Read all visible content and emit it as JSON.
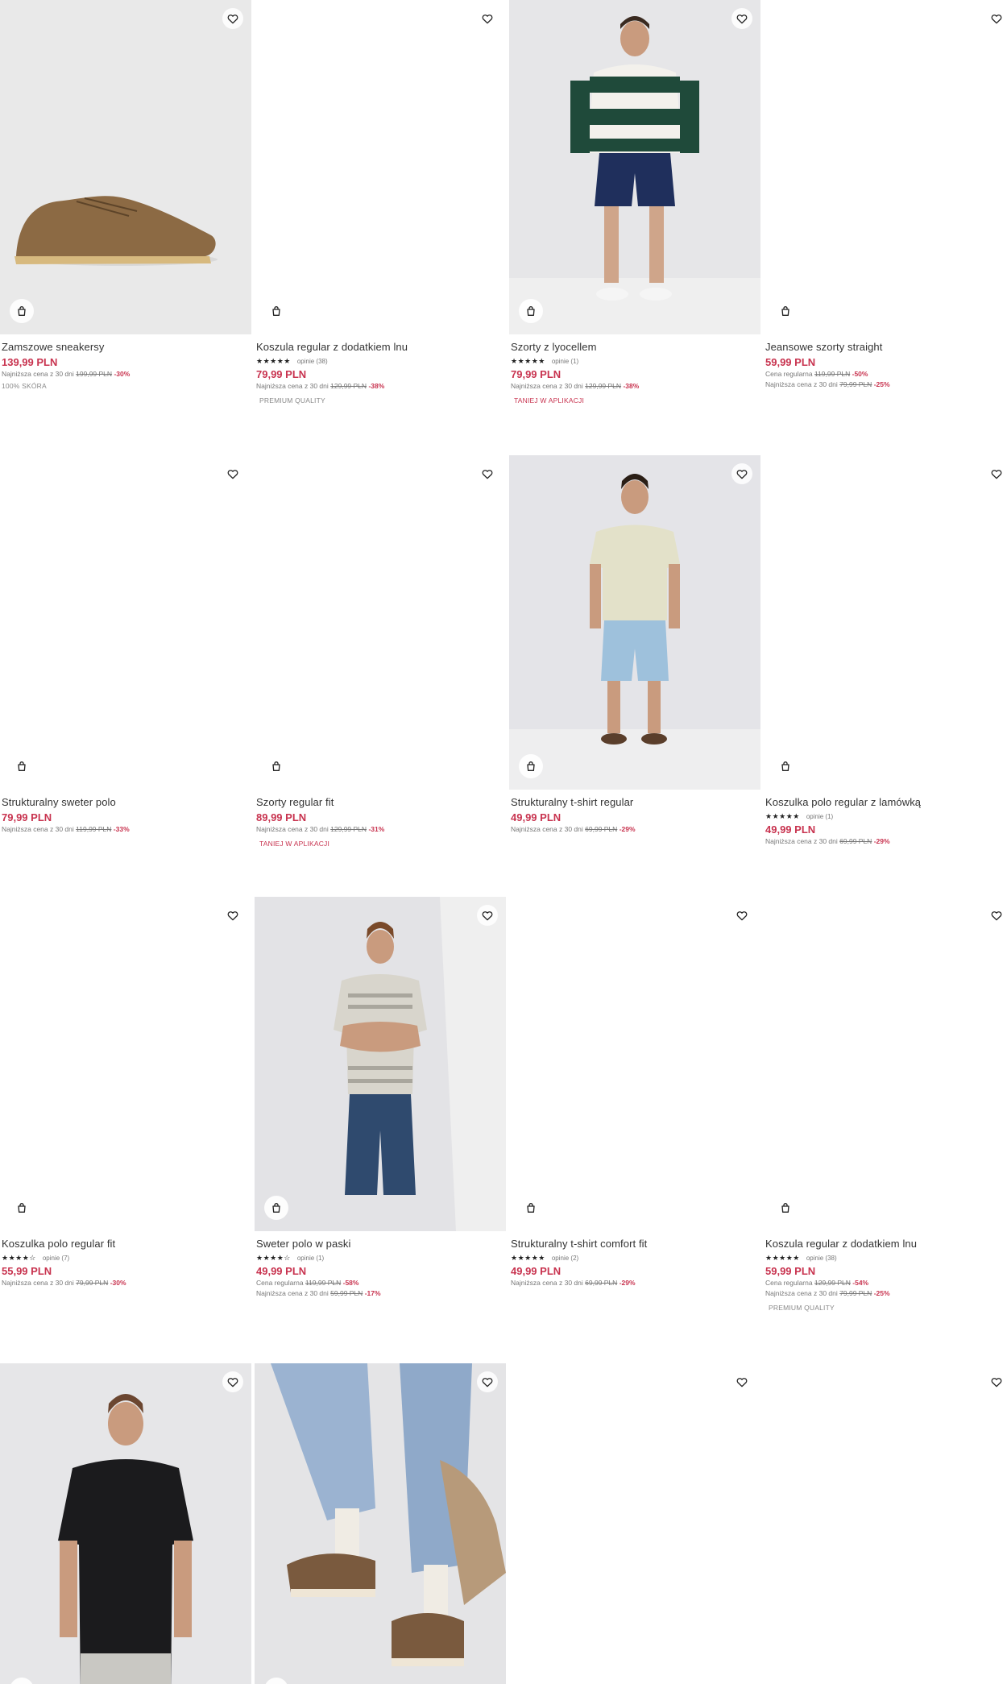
{
  "products": [
    {
      "title": "Zamszowe sneakersy",
      "price": "139,99 PLN",
      "regular_line": "",
      "regular_old": "",
      "regular_disc": "",
      "lowest_label": "Najniższa cena z 30 dni",
      "lowest_old": "199,99 PLN",
      "lowest_disc": "-30%",
      "rating": "",
      "reviews": "",
      "tag": "100% SKÓRA"
    },
    {
      "title": "Koszula regular z dodatkiem lnu",
      "price": "79,99 PLN",
      "regular_line": "",
      "regular_old": "",
      "regular_disc": "",
      "lowest_label": "Najniższa cena z 30 dni",
      "lowest_old": "129,99 PLN",
      "lowest_disc": "-38%",
      "rating": "★★★★★",
      "reviews": "opinie (38)",
      "tag": "PREMIUM QUALITY"
    },
    {
      "title": "Szorty z lyocellem",
      "price": "79,99 PLN",
      "regular_line": "",
      "regular_old": "",
      "regular_disc": "",
      "lowest_label": "Najniższa cena z 30 dni",
      "lowest_old": "129,99 PLN",
      "lowest_disc": "-38%",
      "rating": "★★★★★",
      "reviews": "opinie (1)",
      "tag": "TANIEJ W APLIKACJI"
    },
    {
      "title": "Jeansowe szorty straight",
      "price": "59,99 PLN",
      "regular_line": "Cena regularna",
      "regular_old": "119,99 PLN",
      "regular_disc": "-50%",
      "lowest_label": "Najniższa cena z 30 dni",
      "lowest_old": "79,99 PLN",
      "lowest_disc": "-25%",
      "rating": "",
      "reviews": "",
      "tag": ""
    },
    {
      "title": "Strukturalny sweter polo",
      "price": "79,99 PLN",
      "regular_line": "",
      "regular_old": "",
      "regular_disc": "",
      "lowest_label": "Najniższa cena z 30 dni",
      "lowest_old": "119,99 PLN",
      "lowest_disc": "-33%",
      "rating": "",
      "reviews": "",
      "tag": ""
    },
    {
      "title": "Szorty regular fit",
      "price": "89,99 PLN",
      "regular_line": "",
      "regular_old": "",
      "regular_disc": "",
      "lowest_label": "Najniższa cena z 30 dni",
      "lowest_old": "129,99 PLN",
      "lowest_disc": "-31%",
      "rating": "",
      "reviews": "",
      "tag": "TANIEJ W APLIKACJI"
    },
    {
      "title": "Strukturalny t-shirt regular",
      "price": "49,99 PLN",
      "regular_line": "",
      "regular_old": "",
      "regular_disc": "",
      "lowest_label": "Najniższa cena z 30 dni",
      "lowest_old": "69,99 PLN",
      "lowest_disc": "-29%",
      "rating": "",
      "reviews": "",
      "tag": ""
    },
    {
      "title": "Koszulka polo regular z lamówką",
      "price": "49,99 PLN",
      "regular_line": "",
      "regular_old": "",
      "regular_disc": "",
      "lowest_label": "Najniższa cena z 30 dni",
      "lowest_old": "69,99 PLN",
      "lowest_disc": "-29%",
      "rating": "★★★★★",
      "reviews": "opinie (1)",
      "tag": ""
    },
    {
      "title": "Koszulka polo regular fit",
      "price": "55,99 PLN",
      "regular_line": "",
      "regular_old": "",
      "regular_disc": "",
      "lowest_label": "Najniższa cena z 30 dni",
      "lowest_old": "79,99 PLN",
      "lowest_disc": "-30%",
      "rating": "★★★★☆",
      "reviews": "opinie (7)",
      "tag": ""
    },
    {
      "title": "Sweter polo w paski",
      "price": "49,99 PLN",
      "regular_line": "Cena regularna",
      "regular_old": "119,99 PLN",
      "regular_disc": "-58%",
      "lowest_label": "Najniższa cena z 30 dni",
      "lowest_old": "59,99 PLN",
      "lowest_disc": "-17%",
      "rating": "★★★★☆",
      "reviews": "opinie (1)",
      "tag": ""
    },
    {
      "title": "Strukturalny t-shirt comfort fit",
      "price": "49,99 PLN",
      "regular_line": "",
      "regular_old": "",
      "regular_disc": "",
      "lowest_label": "Najniższa cena z 30 dni",
      "lowest_old": "69,99 PLN",
      "lowest_disc": "-29%",
      "rating": "★★★★★",
      "reviews": "opinie (2)",
      "tag": ""
    },
    {
      "title": "Koszula regular z dodatkiem lnu",
      "price": "59,99 PLN",
      "regular_line": "Cena regularna",
      "regular_old": "129,99 PLN",
      "regular_disc": "-54%",
      "lowest_label": "Najniższa cena z 30 dni",
      "lowest_old": "79,99 PLN",
      "lowest_disc": "-25%",
      "rating": "★★★★★",
      "reviews": "opinie (38)",
      "tag": "PREMIUM QUALITY"
    }
  ],
  "icons": {
    "favorite": "heart-outline-icon",
    "add_to_bag": "shopping-bag-icon"
  },
  "colors": {
    "price": "#c8334f",
    "text": "#333333",
    "muted": "#777777"
  }
}
